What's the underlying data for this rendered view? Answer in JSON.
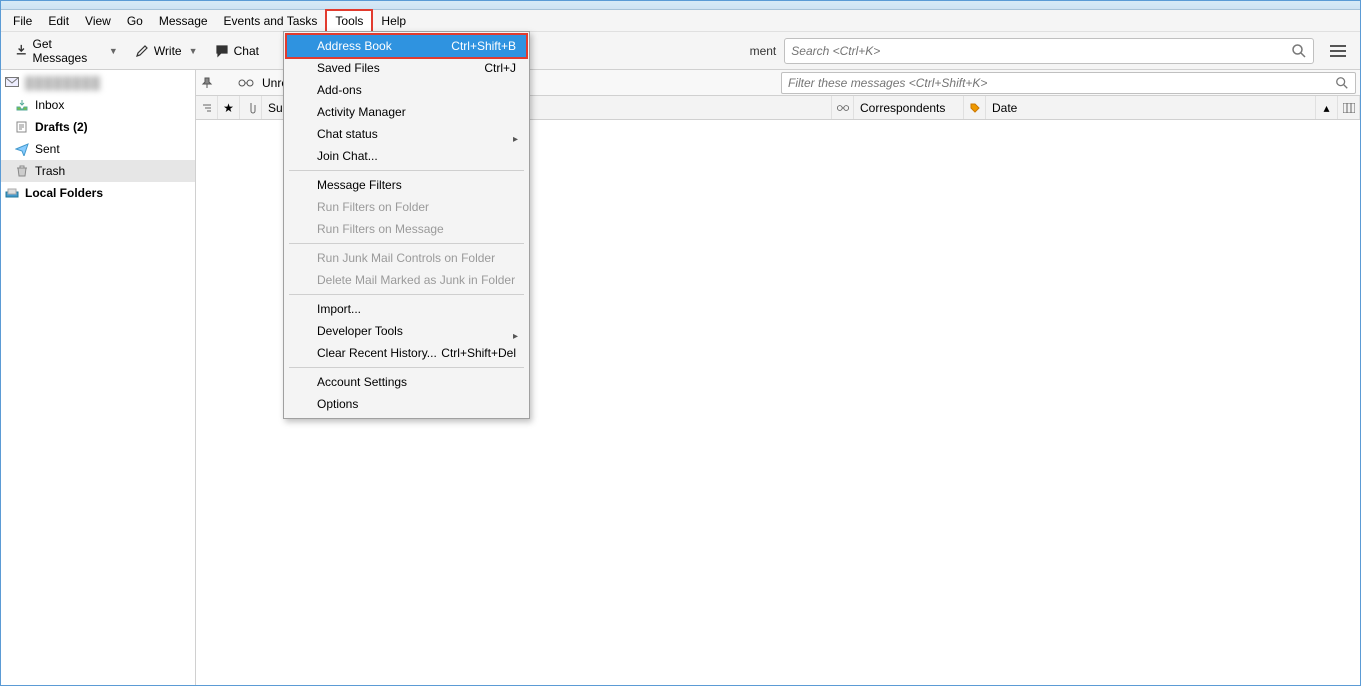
{
  "menubar": {
    "file": "File",
    "edit": "Edit",
    "view": "View",
    "go": "Go",
    "message": "Message",
    "events": "Events and Tasks",
    "tools": "Tools",
    "help": "Help"
  },
  "toolbar": {
    "get_messages": "Get Messages",
    "write": "Write",
    "chat": "Chat",
    "unread_fragment": "Unrea",
    "ment_fragment": "ment",
    "search_placeholder": "Search <Ctrl+K>"
  },
  "sidebar": {
    "account_blur": "████████",
    "inbox": "Inbox",
    "drafts": "Drafts (2)",
    "sent": "Sent",
    "trash": "Trash",
    "local": "Local Folders"
  },
  "tools_menu": {
    "address_book": "Address Book",
    "address_book_sc": "Ctrl+Shift+B",
    "saved_files": "Saved Files",
    "saved_files_sc": "Ctrl+J",
    "add_ons": "Add-ons",
    "activity": "Activity Manager",
    "chat_status": "Chat status",
    "join_chat": "Join Chat...",
    "msg_filters": "Message Filters",
    "run_folder": "Run Filters on Folder",
    "run_message": "Run Filters on Message",
    "junk_folder": "Run Junk Mail Controls on Folder",
    "del_junk": "Delete Mail Marked as Junk in Folder",
    "import": "Import...",
    "dev_tools": "Developer Tools",
    "clear_hist": "Clear Recent History...",
    "clear_hist_sc": "Ctrl+Shift+Del",
    "acct_settings": "Account Settings",
    "options": "Options"
  },
  "filterbar": {
    "unread_fragment": "Su",
    "filter_placeholder": "Filter these messages <Ctrl+Shift+K>"
  },
  "columns": {
    "correspondents": "Correspondents",
    "date": "Date"
  }
}
